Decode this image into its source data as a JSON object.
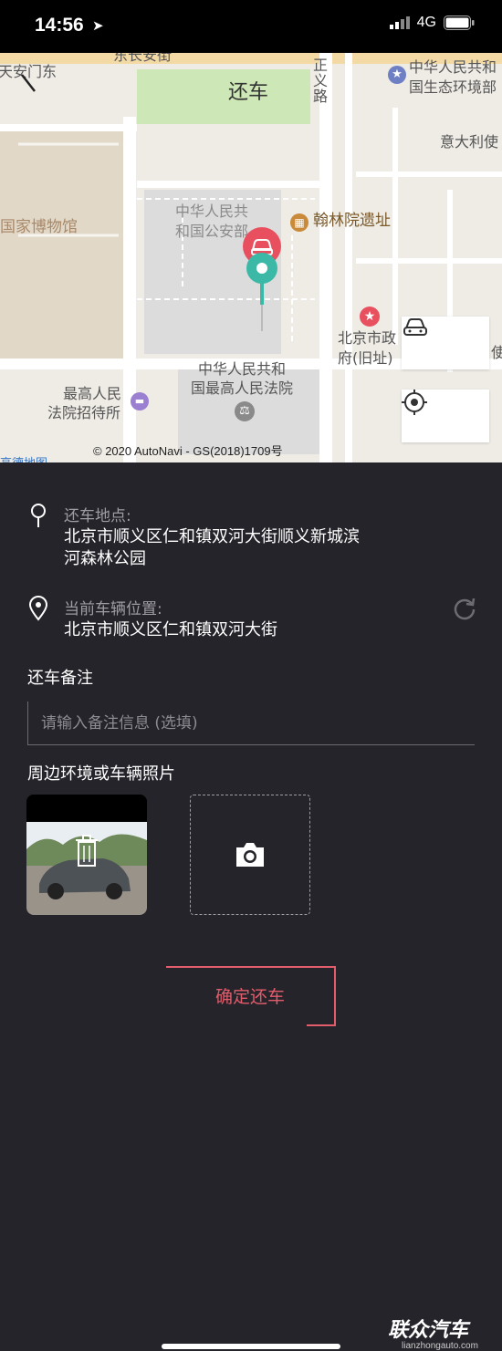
{
  "status": {
    "time": "14:56",
    "network": "4G"
  },
  "map": {
    "title": "还车",
    "labels": {
      "top_left": "天安门东",
      "top_road": "东长安街",
      "right_top1": "中华人民共和",
      "right_top2": "国生态环境部",
      "road_vertical": "正义路",
      "right_italy": "意大利使",
      "museum": "国家博物馆",
      "police1": "中华人民共",
      "police2": "和国公安部",
      "hanlin": "翰林院遗址",
      "gov1": "北京市政",
      "gov2": "府(旧址)",
      "right_shi": "使",
      "court1": "中华人民共和",
      "court2": "国最高人民法院",
      "hotel1": "最高人民",
      "hotel2": "法院招待所",
      "bottom_brand": "高德地图"
    },
    "copyright": "© 2020 AutoNavi - GS(2018)1709号",
    "accent_red": "#e8505f",
    "accent_teal": "#3bb8a6"
  },
  "panel": {
    "return_location_label": "还车地点:",
    "return_location_value": "北京市顺义区仁和镇双河大街顺义新城滨河森林公园",
    "return_location_line1": "北京市顺义区仁和镇双河大街顺义新城滨",
    "return_location_line2": "河森林公园",
    "current_location_label": "当前车辆位置:",
    "current_location_value": "北京市顺义区仁和镇双河大街",
    "note_title": "还车备注",
    "note_placeholder": "请输入备注信息 (选填)",
    "photos_title": "周边环境或车辆照片",
    "confirm_label": "确定还车",
    "confirm_color": "#e25c6c"
  },
  "watermark": {
    "brand": "联众汽车",
    "site": "lianzhongauto.com"
  }
}
